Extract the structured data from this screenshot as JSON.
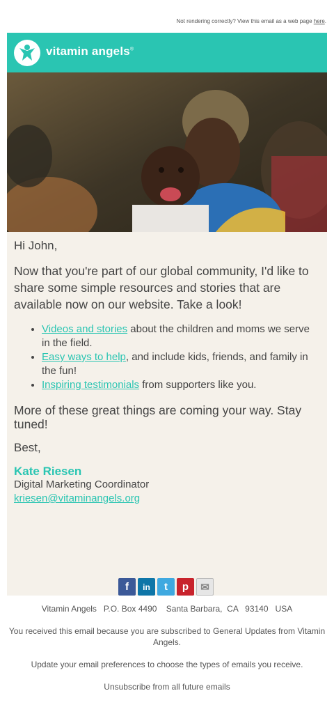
{
  "preheader": {
    "text": "Not rendering correctly? View this email as a web page ",
    "link": "here",
    "suffix": "."
  },
  "brand": {
    "name": "vitamin angels",
    "trademark": "®",
    "color": "#2ac5b2"
  },
  "hero": {
    "icon": "photo-mother-and-baby"
  },
  "letter": {
    "greeting": "Hi John,",
    "intro": "Now that you're part of our global community, I'd like to share some simple resources and stories that are available now on our website. Take a look!",
    "items": [
      {
        "link": "Videos and stories",
        "rest": " about the children and moms we serve in the field."
      },
      {
        "link": "Easy ways to help",
        "rest": ", and include kids, friends, and family in the fun!"
      },
      {
        "link": "Inspiring testimonials",
        "rest": " from supporters like you."
      }
    ],
    "closing": "More of these great things are coming your way. Stay tuned!",
    "signoff": "Best,",
    "name": "Kate Riesen",
    "title": "Digital Marketing Coordinator",
    "email": "kriesen@vitaminangels.org"
  },
  "social": [
    {
      "icon": "facebook-icon",
      "glyph": "f",
      "color": "#3b5998"
    },
    {
      "icon": "linkedin-icon",
      "glyph": "in",
      "color": "#0e76a8"
    },
    {
      "icon": "twitter-icon",
      "glyph": "t",
      "color": "#3fa9e0"
    },
    {
      "icon": "pinterest-icon",
      "glyph": "p",
      "color": "#c8232c"
    },
    {
      "icon": "email-icon",
      "glyph": "✉",
      "color": "#e6e6e6"
    }
  ],
  "footer": {
    "address": "Vitamin Angels   P.O. Box 4490    Santa Barbara,  CA   93140   USA",
    "subscribed": "You received this email because you are subscribed to General Updates from Vitamin Angels.",
    "preferences": "Update your email preferences to choose the types of emails you receive.",
    "unsubscribe": "Unsubscribe from all future emails"
  }
}
